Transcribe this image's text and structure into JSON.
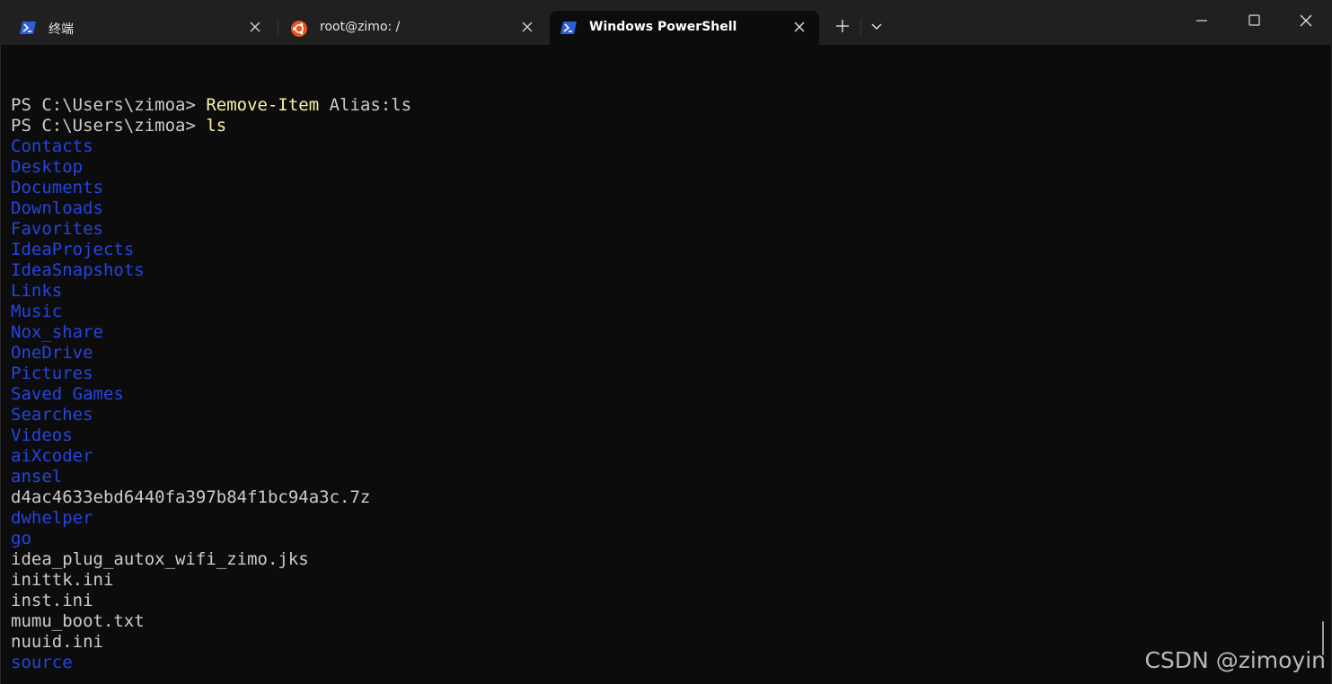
{
  "colors": {
    "titlebar_bg": "#202020",
    "terminal_bg": "#0c0c0c",
    "text_default": "#cccccc",
    "command_yellow": "#f9f1a5",
    "directory_blue": "#2545e0",
    "powershell_icon_blue": "#2b5fd9",
    "ubuntu_orange": "#e95420"
  },
  "tabs": [
    {
      "title": "终端",
      "icon": "powershell-icon",
      "close_icon": "close-icon",
      "active": false
    },
    {
      "title": "root@zimo: /",
      "icon": "ubuntu-icon",
      "close_icon": "close-icon",
      "active": false
    },
    {
      "title": "Windows PowerShell",
      "icon": "powershell-icon",
      "close_icon": "close-icon",
      "active": true
    }
  ],
  "toolbar": {
    "new_tab_icon": "plus-icon",
    "dropdown_icon": "chevron-down-icon"
  },
  "window_controls": {
    "minimize_icon": "minimize-icon",
    "maximize_icon": "maximize-icon",
    "close_icon": "close-icon"
  },
  "terminal": {
    "lines": [
      {
        "prompt": "PS C:\\Users\\zimoa> ",
        "cmd": "Remove-Item",
        "arg": " Alias:ls",
        "style": "cmd"
      },
      {
        "prompt": "PS C:\\Users\\zimoa> ",
        "cmd": "ls",
        "arg": "",
        "style": "cmd"
      },
      {
        "text": "Contacts",
        "style": "dir"
      },
      {
        "text": "Desktop",
        "style": "dir"
      },
      {
        "text": "Documents",
        "style": "dir"
      },
      {
        "text": "Downloads",
        "style": "dir"
      },
      {
        "text": "Favorites",
        "style": "dir"
      },
      {
        "text": "IdeaProjects",
        "style": "dir"
      },
      {
        "text": "IdeaSnapshots",
        "style": "dir"
      },
      {
        "text": "Links",
        "style": "dir"
      },
      {
        "text": "Music",
        "style": "dir"
      },
      {
        "text": "Nox_share",
        "style": "dir"
      },
      {
        "text": "OneDrive",
        "style": "dir"
      },
      {
        "text": "Pictures",
        "style": "dir"
      },
      {
        "text": "Saved Games",
        "style": "dir"
      },
      {
        "text": "Searches",
        "style": "dir"
      },
      {
        "text": "Videos",
        "style": "dir"
      },
      {
        "text": "aiXcoder",
        "style": "dir"
      },
      {
        "text": "ansel",
        "style": "dir"
      },
      {
        "text": "d4ac4633ebd6440fa397b84f1bc94a3c.7z",
        "style": "file"
      },
      {
        "text": "dwhelper",
        "style": "dir"
      },
      {
        "text": "go",
        "style": "dir"
      },
      {
        "text": "idea_plug_autox_wifi_zimo.jks",
        "style": "file"
      },
      {
        "text": "inittk.ini",
        "style": "file"
      },
      {
        "text": "inst.ini",
        "style": "file"
      },
      {
        "text": "mumu_boot.txt",
        "style": "file"
      },
      {
        "text": "nuuid.ini",
        "style": "file"
      },
      {
        "text": "source",
        "style": "dir"
      }
    ]
  },
  "watermark": "CSDN @zimoyin"
}
